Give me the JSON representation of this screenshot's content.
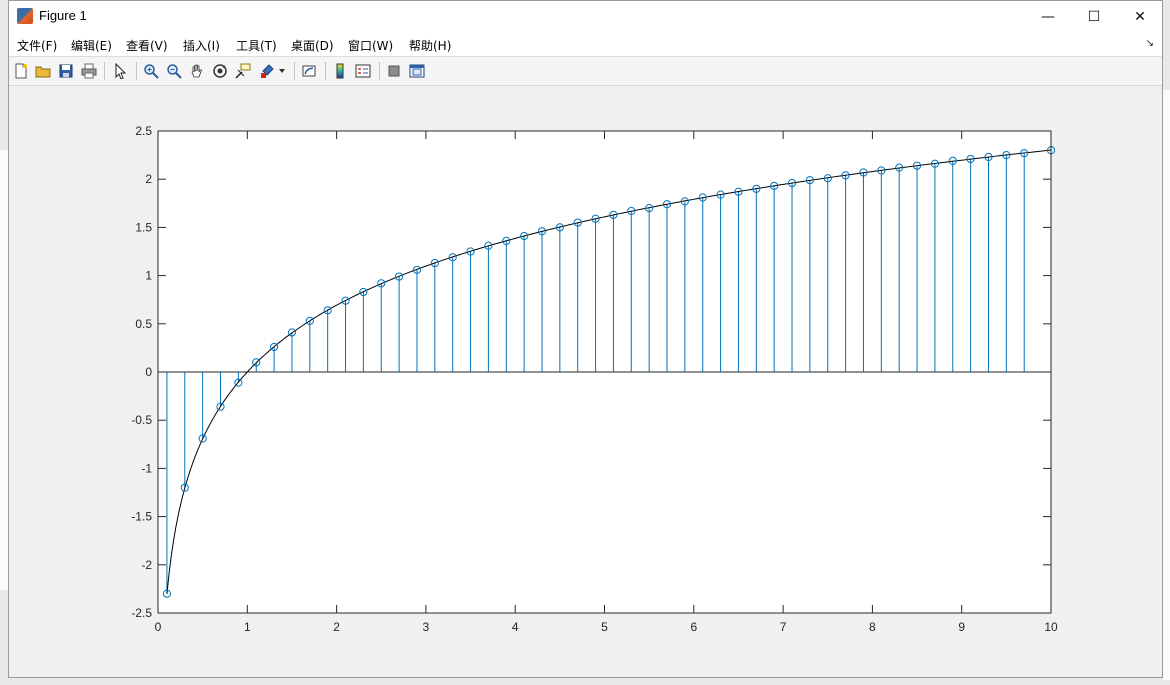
{
  "window": {
    "title": "Figure 1",
    "minimize_glyph": "—",
    "maximize_glyph": "☐",
    "close_glyph": "✕"
  },
  "menu": {
    "items": [
      "文件(F)",
      "编辑(E)",
      "查看(V)",
      "插入(I)",
      "工具(T)",
      "桌面(D)",
      "窗口(W)",
      "帮助(H)"
    ]
  },
  "toolbar": {
    "icons": [
      "new-figure-icon",
      "open-file-icon",
      "save-icon",
      "print-icon",
      "pointer-icon",
      "zoom-in-icon",
      "zoom-out-icon",
      "pan-icon",
      "rotate-3d-icon",
      "data-cursor-icon",
      "brush-icon",
      "link-plot-icon",
      "colorbar-icon",
      "legend-icon",
      "hide-plot-tools-icon",
      "show-plot-tools-icon"
    ]
  },
  "colors": {
    "stem": "#0072BD",
    "curve": "#000000",
    "axes_bg": "#ffffff",
    "figure_bg": "#f0f0f0"
  },
  "chart_data": {
    "type": "stem+line",
    "title": "",
    "xlabel": "",
    "ylabel": "",
    "xlim": [
      0,
      10
    ],
    "ylim": [
      -2.5,
      2.5
    ],
    "xticks": [
      "0",
      "1",
      "2",
      "3",
      "4",
      "5",
      "6",
      "7",
      "8",
      "9",
      "10"
    ],
    "yticks": [
      "-2.5",
      "-2",
      "-1.5",
      "-1",
      "-0.5",
      "0",
      "0.5",
      "1",
      "1.5",
      "2",
      "2.5"
    ],
    "grid": false,
    "legend": "none",
    "series": [
      {
        "kind": "stem",
        "marker": "circle",
        "x": [
          0.1,
          0.3,
          0.5,
          0.7,
          0.9,
          1.1,
          1.3,
          1.5,
          1.7,
          1.9,
          2.1,
          2.3,
          2.5,
          2.7,
          2.9,
          3.1,
          3.3,
          3.5,
          3.7,
          3.9,
          4.1,
          4.3,
          4.5,
          4.7,
          4.9,
          5.1,
          5.3,
          5.5,
          5.7,
          5.9,
          6.1,
          6.3,
          6.5,
          6.7,
          6.9,
          7.1,
          7.3,
          7.5,
          7.7,
          7.9,
          8.1,
          8.3,
          8.5,
          8.7,
          8.9,
          9.1,
          9.3,
          9.5,
          9.7,
          10.0
        ],
        "y": [
          -2.3,
          -1.2,
          -0.69,
          -0.36,
          -0.11,
          0.1,
          0.26,
          0.41,
          0.53,
          0.64,
          0.74,
          0.83,
          0.92,
          0.99,
          1.06,
          1.13,
          1.19,
          1.25,
          1.31,
          1.36,
          1.41,
          1.46,
          1.5,
          1.55,
          1.59,
          1.63,
          1.67,
          1.7,
          1.74,
          1.77,
          1.81,
          1.84,
          1.87,
          1.9,
          1.93,
          1.96,
          1.99,
          2.01,
          2.04,
          2.07,
          2.09,
          2.12,
          2.14,
          2.16,
          2.19,
          2.21,
          2.23,
          2.25,
          2.27,
          2.3
        ]
      },
      {
        "kind": "line",
        "x_start": 0.1,
        "x_end": 10,
        "function": "ln(x)"
      }
    ]
  }
}
